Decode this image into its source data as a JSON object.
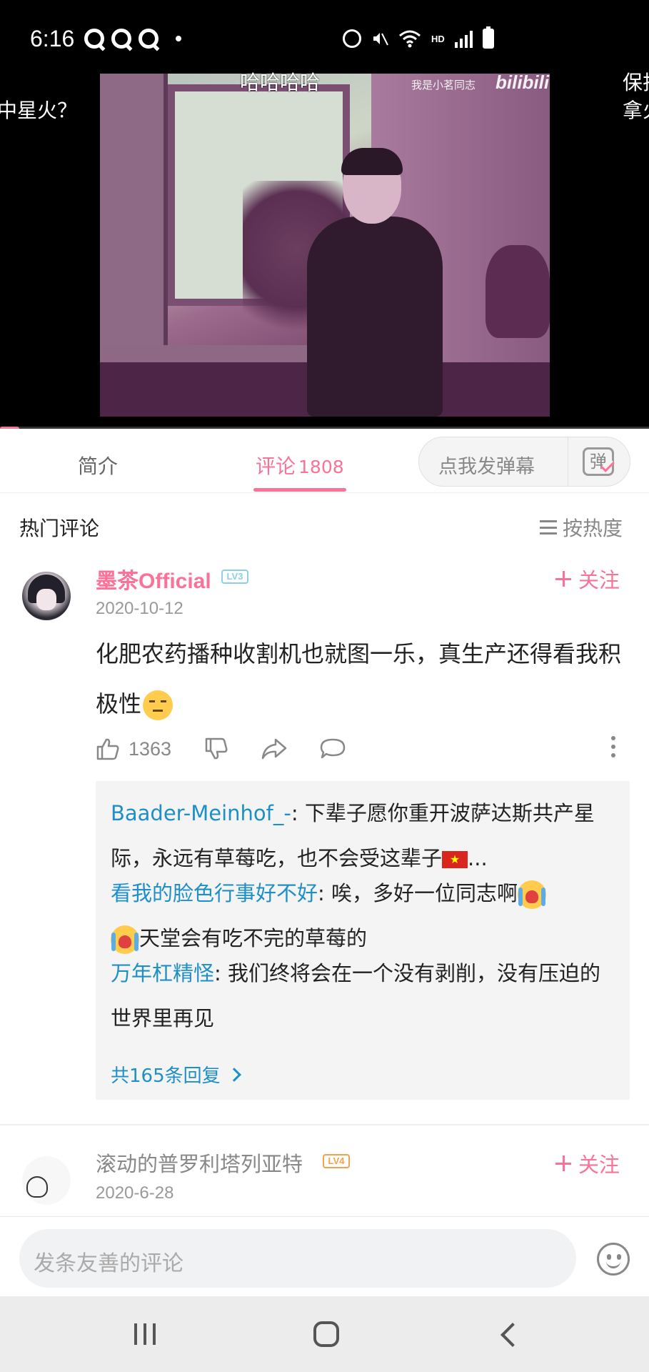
{
  "status_bar": {
    "time": "6:16",
    "network": "HD"
  },
  "video": {
    "watermark_text": "我是小茗同志",
    "watermark_logo": "bilibili",
    "danmaku": [
      "哈哈哈哈",
      "中星火？",
      "保护",
      "拿火"
    ],
    "progress_fraction": 0.03
  },
  "tabs": {
    "intro_label": "简介",
    "comments_label": "评论",
    "comments_count": "1808",
    "danmaku_button_label": "点我发弹幕",
    "danmaku_toggle_glyph": "弹"
  },
  "hot_comments": {
    "title": "热门评论",
    "sort_label": "按热度"
  },
  "comment1": {
    "username": "墨茶Official",
    "level": "LV3",
    "follow_label": "关注",
    "date": "2020-10-12",
    "text": "化肥农药播种收割机也就图一乐，真生产还得看我积极性",
    "likes": "1363",
    "replies": [
      {
        "user": "Baader-Meinhof_-",
        "text": ": 下辈子愿你重开波萨达斯共产星际，永远有草莓吃，也不会受这辈子",
        "suffix": "..."
      },
      {
        "user": "看我的脸色行事好不好",
        "text": ": 唉，多好一位同志啊",
        "text2": "天堂会有吃不完的草莓的"
      },
      {
        "user": "万年杠精怪",
        "text": ": 我们终将会在一个没有剥削，没有压迫的世界里再见"
      }
    ],
    "more_replies_label": "共165条回复"
  },
  "comment2": {
    "username": "滚动的普罗利塔列亚特",
    "level": "LV4",
    "follow_label": "关注",
    "date": "2020-6-28"
  },
  "input": {
    "placeholder": "发条友善的评论"
  },
  "colors": {
    "accent": "#fb7299",
    "link": "#1f8fc7"
  }
}
